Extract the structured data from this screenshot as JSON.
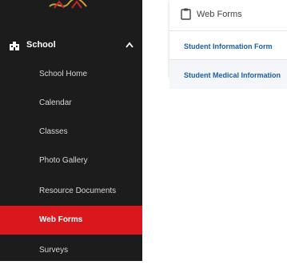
{
  "sidebar": {
    "section_title": "School",
    "items": [
      {
        "label": "School Home"
      },
      {
        "label": "Calendar"
      },
      {
        "label": "Classes"
      },
      {
        "label": "Photo Gallery"
      },
      {
        "label": "Resource Documents"
      },
      {
        "label": "Web Forms",
        "active": true
      },
      {
        "label": "Surveys"
      }
    ]
  },
  "card": {
    "title": "Web Forms",
    "links": [
      {
        "label": "Student Information Form"
      },
      {
        "label": "Student Medical Information"
      }
    ]
  },
  "colors": {
    "sidebar_bg": "#1c1c1c",
    "active_bg": "#d9171d",
    "link_color": "#1a5fa6"
  },
  "icons": {
    "school": "school-building-icon",
    "caret": "chevron-up-icon",
    "clipboard": "clipboard-icon"
  }
}
